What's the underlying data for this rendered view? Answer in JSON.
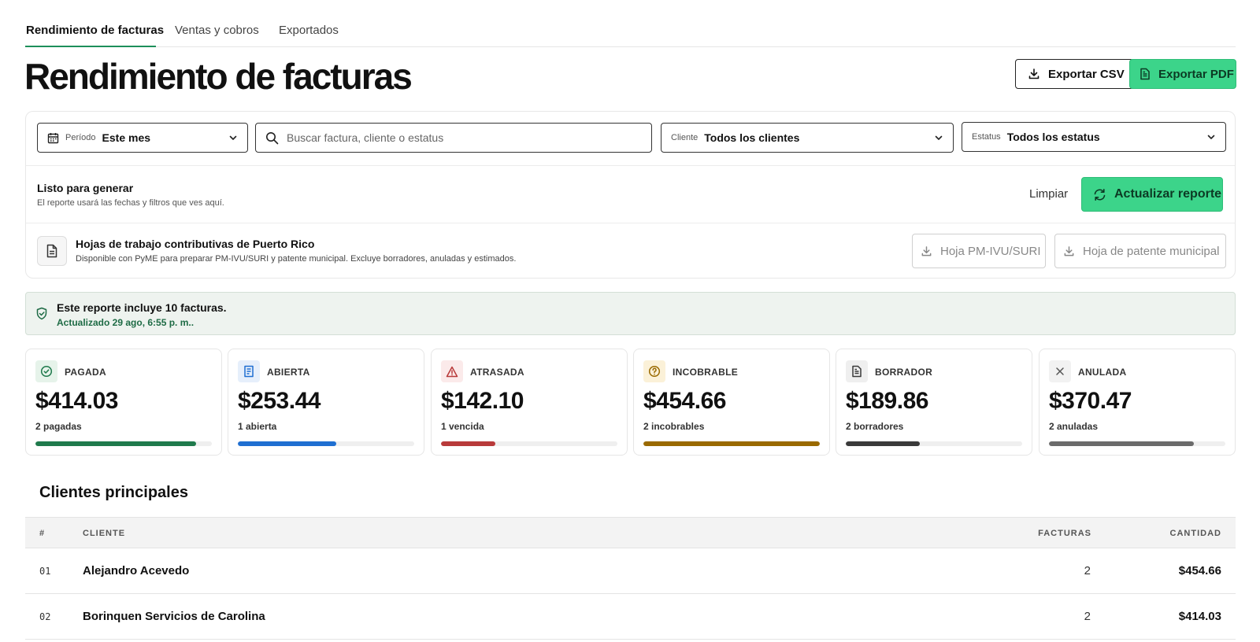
{
  "tabs": [
    {
      "label": "Rendimiento de facturas",
      "active": true
    },
    {
      "label": "Ventas y cobros",
      "active": false
    },
    {
      "label": "Exportados",
      "active": false
    }
  ],
  "header": {
    "title": "Rendimiento de facturas",
    "export_csv_label": "Exportar CSV",
    "export_pdf_label": "Exportar PDF"
  },
  "filters": {
    "period": {
      "label": "Período",
      "value": "Este mes",
      "icon": "calendar-icon"
    },
    "search": {
      "placeholder": "Buscar factura, cliente o estatus",
      "value": ""
    },
    "client": {
      "label": "Cliente",
      "value": "Todos los clientes"
    },
    "status": {
      "label": "Estatus",
      "value": "Todos los estatus"
    }
  },
  "generate": {
    "title": "Listo para generar",
    "subtitle": "El reporte usará las fechas y filtros que ves aquí.",
    "clear_label": "Limpiar",
    "refresh_label": "Actualizar reporte"
  },
  "worksheets": {
    "title": "Hojas de trabajo contributivas de Puerto Rico",
    "subtitle": "Disponible con PyME para preparar PM-IVU/SURI y patente municipal. Excluye borradores, anuladas y estimados.",
    "pm_label": "Hoja PM-IVU/SURI",
    "patente_label": "Hoja de patente municipal"
  },
  "banner": {
    "title": "Este reporte incluye 10 facturas.",
    "updated": "Actualizado 29 ago, 6:55 p. m.."
  },
  "cards": [
    {
      "label": "PAGADA",
      "amount": "$414.03",
      "sub": "2 pagadas",
      "fill": 0.91,
      "color": "#1f7a4c",
      "icon_bg": "#e6f3ea",
      "icon": "check-circle-icon"
    },
    {
      "label": "ABIERTA",
      "amount": "$253.44",
      "sub": "1 abierta",
      "fill": 0.56,
      "color": "#1f6fd1",
      "icon_bg": "#e6effb",
      "icon": "document-icon"
    },
    {
      "label": "ATRASADA",
      "amount": "$142.10",
      "sub": "1 vencida",
      "fill": 0.31,
      "color": "#b83a3a",
      "icon_bg": "#fbeaea",
      "icon": "warning-icon"
    },
    {
      "label": "INCOBRABLE",
      "amount": "$454.66",
      "sub": "2 incobrables",
      "fill": 1.0,
      "color": "#9a6a00",
      "icon_bg": "#fbf1d8",
      "icon": "question-circle-icon"
    },
    {
      "label": "BORRADOR",
      "amount": "$189.86",
      "sub": "2 borradores",
      "fill": 0.42,
      "color": "#3a3a3a",
      "icon_bg": "#efefef",
      "icon": "draft-icon"
    },
    {
      "label": "ANULADA",
      "amount": "$370.47",
      "sub": "2 anuladas",
      "fill": 0.82,
      "color": "#6b6b6b",
      "icon_bg": "#f2f2f2",
      "icon": "x-icon"
    }
  ],
  "clients": {
    "title": "Clientes principales",
    "columns": [
      "#",
      "CLIENTE",
      "FACTURAS",
      "CANTIDAD"
    ],
    "rows": [
      {
        "num": "01",
        "name": "Alejandro Acevedo",
        "invoices": "2",
        "amount": "$454.66"
      },
      {
        "num": "02",
        "name": "Borinquen Servicios de Carolina",
        "invoices": "2",
        "amount": "$414.03"
      }
    ]
  }
}
